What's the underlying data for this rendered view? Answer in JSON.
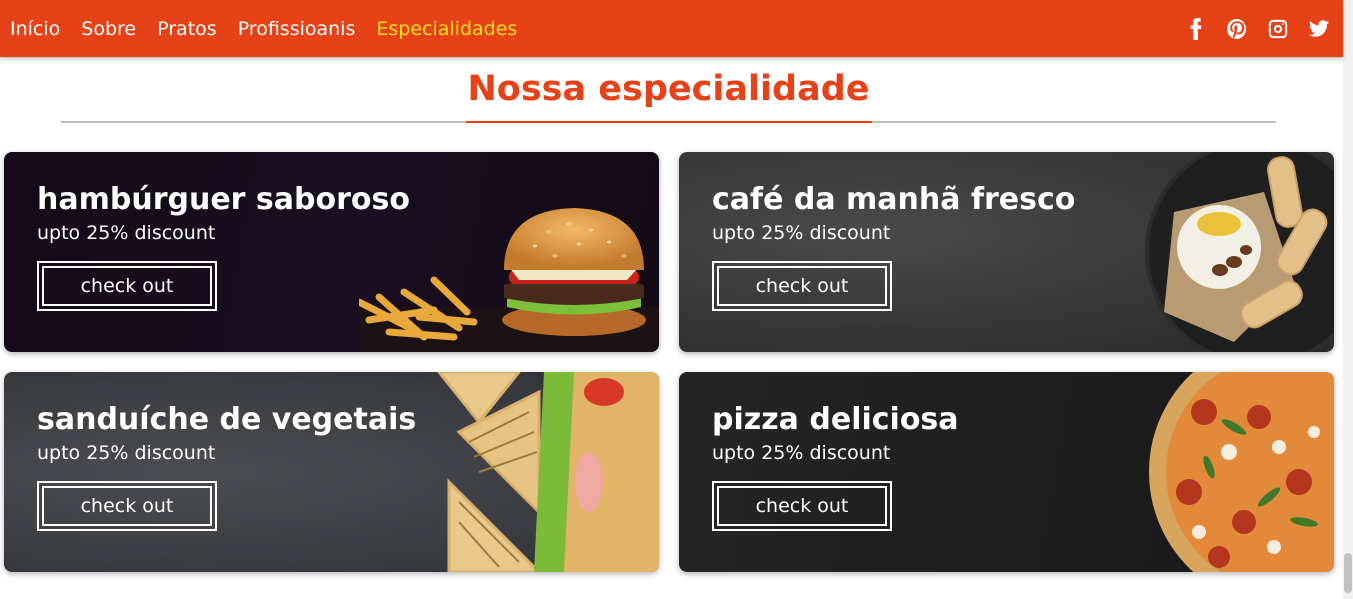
{
  "nav": {
    "links": [
      "Início",
      "Sobre",
      "Pratos",
      "Profissioanis",
      "Especialidades"
    ],
    "active_index": 4,
    "social_icons": [
      "facebook-icon",
      "pinterest-icon",
      "instagram-icon",
      "twitter-icon"
    ]
  },
  "section": {
    "title": "Nossa especialidade"
  },
  "cards": [
    {
      "title": "hambúrguer saboroso",
      "subtitle": "upto 25% discount",
      "button": "check out",
      "image": "burger-and-fries-image"
    },
    {
      "title": "café da manhã fresco",
      "subtitle": "upto 25% discount",
      "button": "check out",
      "image": "breakfast-plate-image"
    },
    {
      "title": "sanduíche de vegetais",
      "subtitle": "upto 25% discount",
      "button": "check out",
      "image": "sandwich-image"
    },
    {
      "title": "pizza deliciosa",
      "subtitle": "upto 25% discount",
      "button": "check out",
      "image": "pizza-image"
    }
  ],
  "colors": {
    "brand": "#e64117",
    "active_link": "#ffe21c",
    "text_light": "#ffffff",
    "divider": "#bdbdbd"
  }
}
